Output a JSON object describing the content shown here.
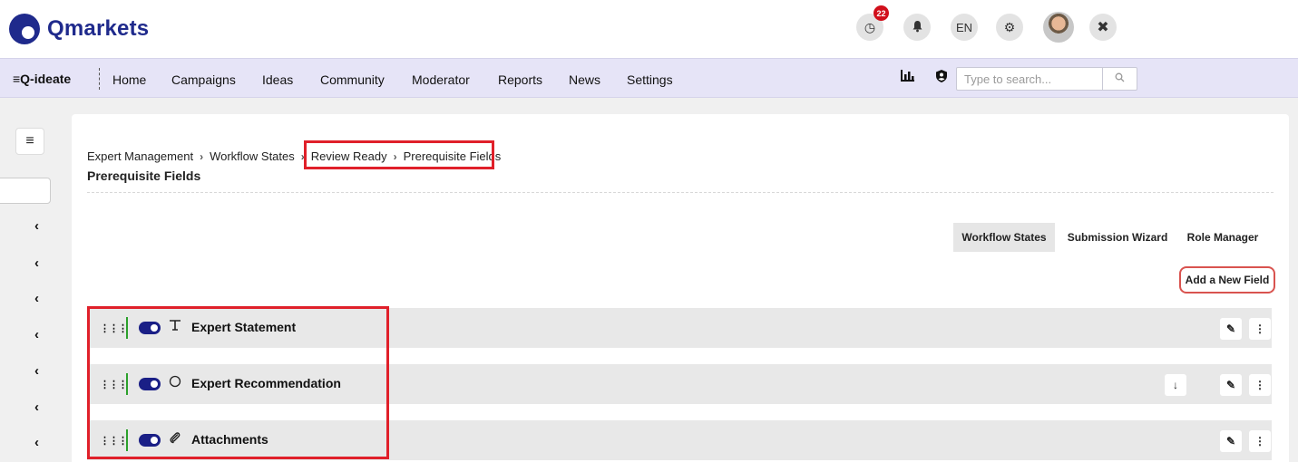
{
  "header": {
    "logo_text": "Qmarkets",
    "notification_count": "22",
    "language": "EN",
    "icons": [
      "timer-icon",
      "bell-icon",
      "gear-icon",
      "avatar",
      "tools-icon"
    ]
  },
  "nav": {
    "brand": "≡Q-ideate",
    "items": [
      "Home",
      "Campaigns",
      "Ideas",
      "Community",
      "Moderator",
      "Reports",
      "News",
      "Settings"
    ],
    "search_placeholder": "Type to search..."
  },
  "breadcrumb": {
    "items": [
      "Expert Management",
      "Workflow States",
      "Review Ready",
      "Prerequisite Fields"
    ]
  },
  "page": {
    "title": "Prerequisite Fields"
  },
  "tabs": [
    {
      "label": "Workflow States",
      "active": true
    },
    {
      "label": "Submission Wizard",
      "active": false
    },
    {
      "label": "Role Manager",
      "active": false
    }
  ],
  "actions": {
    "add_field_label": "Add a New Field"
  },
  "fields": [
    {
      "label": "Expert Statement",
      "type_icon": "text-format-icon",
      "enabled": true
    },
    {
      "label": "Expert Recommendation",
      "type_icon": "radio-icon",
      "enabled": true
    },
    {
      "label": "Attachments",
      "type_icon": "paperclip-icon",
      "enabled": true
    }
  ],
  "colors": {
    "brand": "#1f2a8c",
    "nav_bg": "#e6e4f7",
    "highlight": "#e0202a",
    "toggle": "#1a1f86",
    "status_bar": "#2ca02c"
  }
}
